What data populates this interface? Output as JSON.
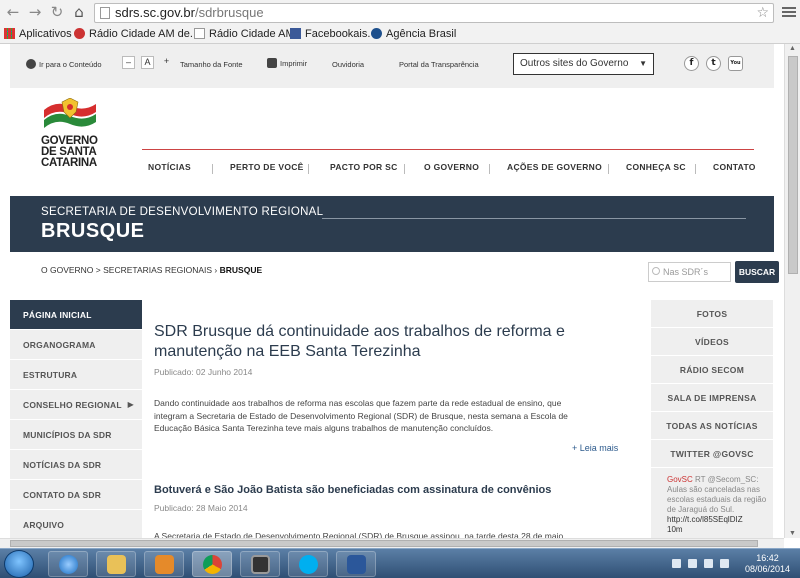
{
  "browser": {
    "url_host": "sdrs.sc.gov.br",
    "url_path": "/sdrbrusque",
    "bookmarks": [
      {
        "label": "Aplicativos"
      },
      {
        "label": "Rádio Cidade AM de..."
      },
      {
        "label": "Rádio Cidade AM"
      },
      {
        "label": "Facebookais."
      },
      {
        "label": "Agência Brasil"
      }
    ]
  },
  "topbar": {
    "skip_link": "Ir para o Conteúdo",
    "font_minus": "–",
    "font_normal": "A",
    "font_plus": "+",
    "font_size_label": "Tamanho da Fonte",
    "print": "Imprimir",
    "ombudsman": "Ouvidoria",
    "transparency": "Portal da Transparência",
    "other_sites": "Outros sites do Governo",
    "social": [
      "f",
      "t",
      "You"
    ]
  },
  "header": {
    "logo_lines": [
      "GOVERNO",
      "DE SANTA",
      "CATARINA"
    ],
    "nav": [
      "NOTÍCIAS",
      "PERTO DE VOCÊ",
      "PACTO POR SC",
      "O GOVERNO",
      "AÇÕES DE GOVERNO",
      "CONHEÇA SC",
      "CONTATO"
    ]
  },
  "banner": {
    "line1": "SECRETARIA DE DESENVOLVIMENTO REGIONAL",
    "line2": "BRUSQUE"
  },
  "breadcrumb": {
    "path": "O GOVERNO > SECRETARIAS REGIONAIS ›",
    "current": "BRUSQUE"
  },
  "search": {
    "placeholder": "Nas SDR´s",
    "button": "BUSCAR"
  },
  "left_nav": [
    {
      "label": "PÁGINA INICIAL",
      "active": true
    },
    {
      "label": "ORGANOGRAMA"
    },
    {
      "label": "ESTRUTURA"
    },
    {
      "label": "CONSELHO REGIONAL",
      "has_sub": true
    },
    {
      "label": "MUNICÍPIOS DA SDR"
    },
    {
      "label": "NOTÍCIAS DA SDR"
    },
    {
      "label": "CONTATO DA SDR"
    },
    {
      "label": "ARQUIVO"
    }
  ],
  "articles": [
    {
      "title_line1": "SDR Brusque dá continuidade aos trabalhos de reforma e",
      "title_line2": "manutenção na EEB Santa Terezinha",
      "date": "Publicado: 02 Junho 2014",
      "body_line1": "Dando continuidade aos trabalhos de reforma nas escolas que fazem parte da rede estadual de ensino, que",
      "body_line2": "integram a Secretaria de Estado de Desenvolvimento Regional (SDR) de Brusque, nesta semana a Escola de",
      "body_line3": "Educação Básica Santa Terezinha teve mais alguns trabalhos de manutenção concluídos.",
      "read_more": "+ Leia mais"
    },
    {
      "title": "Botuverá e São João Batista são beneficiadas com assinatura de convênios",
      "date": "Publicado: 28 Maio 2014",
      "body_partial": "A Secretaria de Estado de Desenvolvimento Regional (SDR) de Brusque assinou, na tarde desta 28 de maio"
    }
  ],
  "right_nav": [
    "FOTOS",
    "VÍDEOS",
    "RÁDIO SECOM",
    "SALA DE IMPRENSA",
    "TODAS AS NOTÍCIAS",
    "TWITTER @GOVSC"
  ],
  "tweet": {
    "user": "GovSC",
    "rt": " RT ",
    "mention": "@Secom_SC",
    "text": ": Aulas são canceladas nas escolas estaduais da região de Jaraguá do Sul.",
    "link": "http://t.co/l85SEqlDIZ",
    "age": "10m"
  },
  "taskbar": {
    "time": "16:42",
    "date": "08/06/2014"
  },
  "colors": {
    "navy": "#2c3c4e",
    "accent_red": "#c44444",
    "sidebar_gray": "#efefef"
  }
}
